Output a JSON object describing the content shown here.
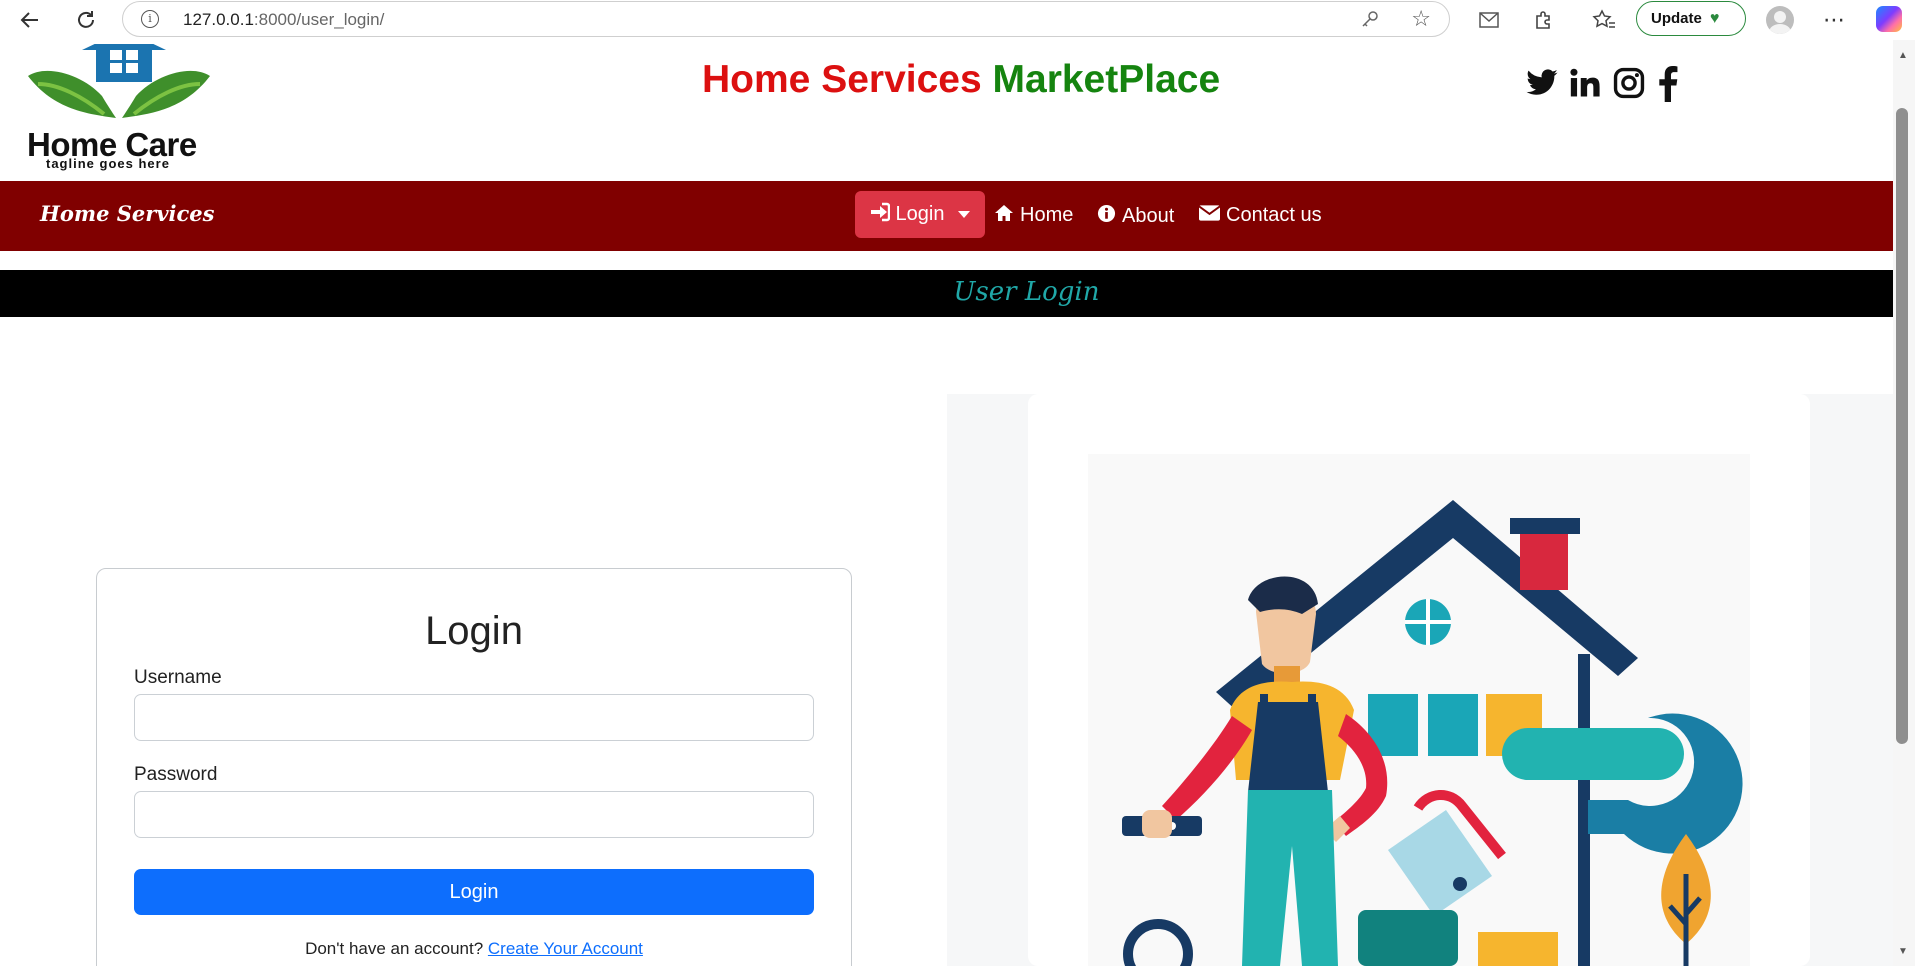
{
  "browser": {
    "url_host": "127.0.0.1",
    "url_rest": ":8000/user_login/",
    "update_label": "Update",
    "icons": [
      "back-icon",
      "refresh-icon",
      "info-icon",
      "key-icon",
      "star-icon",
      "mail-icon",
      "extensions-icon",
      "favorites-icon",
      "heart-icon",
      "profile-icon",
      "more-icon",
      "copilot-icon"
    ]
  },
  "header": {
    "logo": {
      "brand": "Home Care",
      "tagline": "tagline goes here"
    },
    "title_part1": "Home Services",
    "title_part2": "MarketPlace",
    "title_colors": {
      "part1": "#dc1010",
      "part2": "#15840f"
    },
    "socials": [
      "twitter-icon",
      "linkedin-icon",
      "instagram-icon",
      "facebook-icon"
    ]
  },
  "navbar": {
    "brand": "Home Services",
    "background": "#800000",
    "login_label": "Login",
    "links": [
      {
        "label": "Home",
        "icon": "home-icon"
      },
      {
        "label": "About",
        "icon": "info-circle-icon"
      },
      {
        "label": "Contact us",
        "icon": "envelope-icon"
      }
    ]
  },
  "banner": {
    "text": "User Login"
  },
  "login_form": {
    "title": "Login",
    "username_label": "Username",
    "username_value": "",
    "password_label": "Password",
    "password_value": "",
    "submit_label": "Login",
    "signup_prompt": "Don't have an account?",
    "signup_link": "Create Your Account",
    "accent": "#0d6efd"
  },
  "illustration": {
    "subject": "handyman-with-house-illustration"
  }
}
